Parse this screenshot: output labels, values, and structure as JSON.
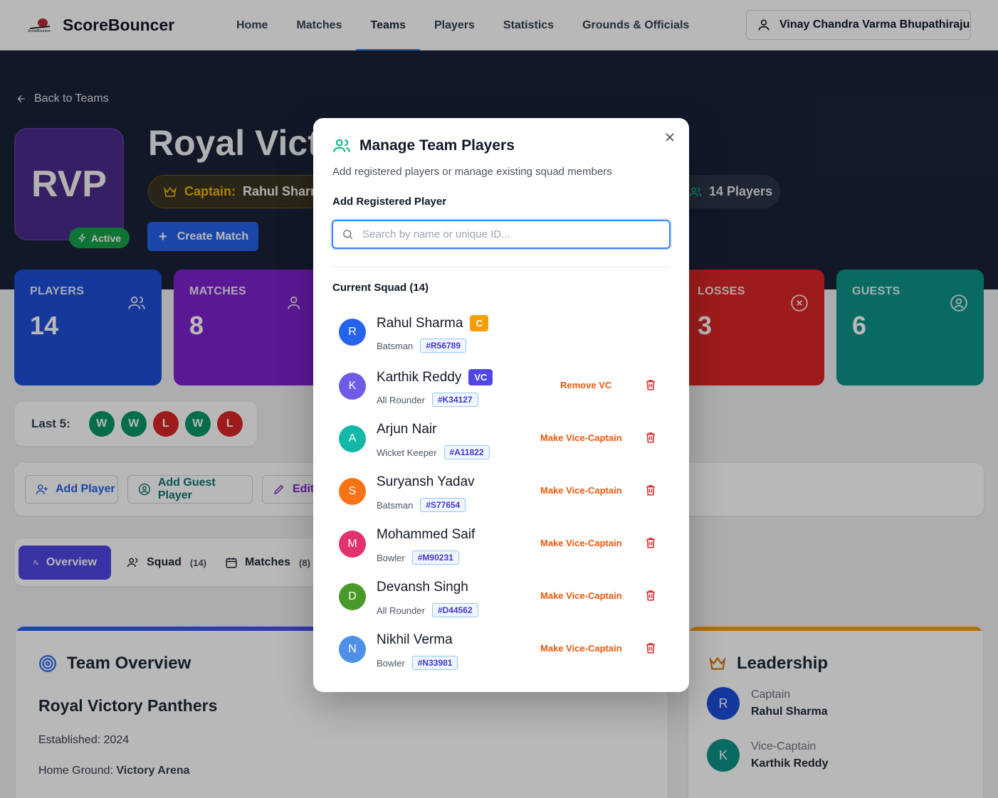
{
  "nav": {
    "brand": "ScoreBouncer",
    "brand_logo_text": "ScoreBouncer",
    "links": [
      "Home",
      "Matches",
      "Teams",
      "Players",
      "Statistics",
      "Grounds & Officials"
    ],
    "active_link": "Teams",
    "user_name": "Vinay Chandra Varma Bhupathiraju"
  },
  "hero": {
    "back_label": "Back to Teams",
    "logo_text": "RVP",
    "status": "Active",
    "team_name": "Royal Victory Panthers",
    "captain_key": "Captain:",
    "captain_value": "Rahul Sharma",
    "players_count": "14 Players",
    "create_match": "Create Match"
  },
  "stats": [
    {
      "label": "PLAYERS",
      "value": "14",
      "color": "#1d4ed8",
      "icon": "users-icon"
    },
    {
      "label": "MATCHES",
      "value": "8",
      "color": "#7e22ce",
      "icon": "users-icon"
    },
    {
      "label": "LOSSES",
      "value": "3",
      "color": "#dc2626",
      "icon": "x-circle-icon"
    },
    {
      "label": "GUESTS",
      "value": "6",
      "color": "#0d9488",
      "icon": "user-circle-icon"
    }
  ],
  "last5": {
    "label": "Last 5:",
    "results": [
      "W",
      "W",
      "L",
      "W",
      "L"
    ],
    "win_color": "#059669",
    "loss_color": "#dc2626"
  },
  "actions": {
    "add_player": "Add Player",
    "add_guest": "Add Guest Player",
    "edit": "Edit"
  },
  "tabs": {
    "overview": "Overview",
    "squad": "Squad",
    "squad_count": "(14)",
    "matches": "Matches",
    "matches_count": "(8)"
  },
  "overview": {
    "heading": "Team Overview",
    "team_name": "Royal Victory Panthers",
    "established": "Established: 2024",
    "home_ground_key": "Home Ground:",
    "home_ground_value": "Victory Arena"
  },
  "leadership": {
    "heading": "Leadership",
    "captain_role": "Captain",
    "captain_name": "Rahul Sharma",
    "captain_initial": "R",
    "vc_role": "Vice-Captain",
    "vc_name": "Karthik Reddy",
    "vc_initial": "K"
  },
  "modal": {
    "title": "Manage Team Players",
    "subtitle": "Add registered players or manage existing squad members",
    "add_label": "Add Registered Player",
    "search_placeholder": "Search by name or unique ID...",
    "squad_label": "Current Squad (14)",
    "players": [
      {
        "initial": "R",
        "name": "Rahul Sharma",
        "role": "Batsman",
        "id": "#R56789",
        "badge": "C",
        "badge_color": "#f59e0b",
        "action": "",
        "avatar_color": "#2563eb"
      },
      {
        "initial": "K",
        "name": "Karthik Reddy",
        "role": "All Rounder",
        "id": "#K34127",
        "badge": "VC",
        "badge_color": "#4f46e5",
        "action": "Remove VC",
        "avatar_color": "#6d5ce6"
      },
      {
        "initial": "A",
        "name": "Arjun Nair",
        "role": "Wicket Keeper",
        "id": "#A11822",
        "badge": "",
        "badge_color": "",
        "action": "Make Vice-Captain",
        "avatar_color": "#14b8a6"
      },
      {
        "initial": "S",
        "name": "Suryansh Yadav",
        "role": "Batsman",
        "id": "#S77654",
        "badge": "",
        "badge_color": "",
        "action": "Make Vice-Captain",
        "avatar_color": "#f97316"
      },
      {
        "initial": "M",
        "name": "Mohammed Saif",
        "role": "Bowler",
        "id": "#M90231",
        "badge": "",
        "badge_color": "",
        "action": "Make Vice-Captain",
        "avatar_color": "#e2336b"
      },
      {
        "initial": "D",
        "name": "Devansh Singh",
        "role": "All Rounder",
        "id": "#D44562",
        "badge": "",
        "badge_color": "",
        "action": "Make Vice-Captain",
        "avatar_color": "#4a9a2a"
      },
      {
        "initial": "N",
        "name": "Nikhil Verma",
        "role": "Bowler",
        "id": "#N33981",
        "badge": "",
        "badge_color": "",
        "action": "Make Vice-Captain",
        "avatar_color": "#4f8fe8"
      }
    ]
  }
}
